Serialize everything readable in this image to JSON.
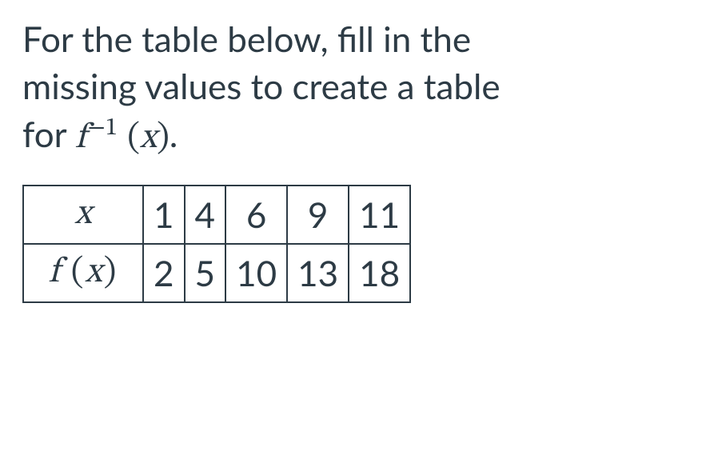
{
  "prompt": {
    "line1": "For the table below, fill in the",
    "line2": "missing values to create a table",
    "line3_prefix": "for ",
    "line3_func_base": "f",
    "line3_func_sup": "−1",
    "line3_func_arg": "x",
    "line3_suffix": "."
  },
  "table": {
    "row1_label_var": "x",
    "row1": [
      "1",
      "4",
      "6",
      "9",
      "11"
    ],
    "row2_label_func": "f",
    "row2_label_arg": "x",
    "row2": [
      "2",
      "5",
      "10",
      "13",
      "18"
    ]
  }
}
